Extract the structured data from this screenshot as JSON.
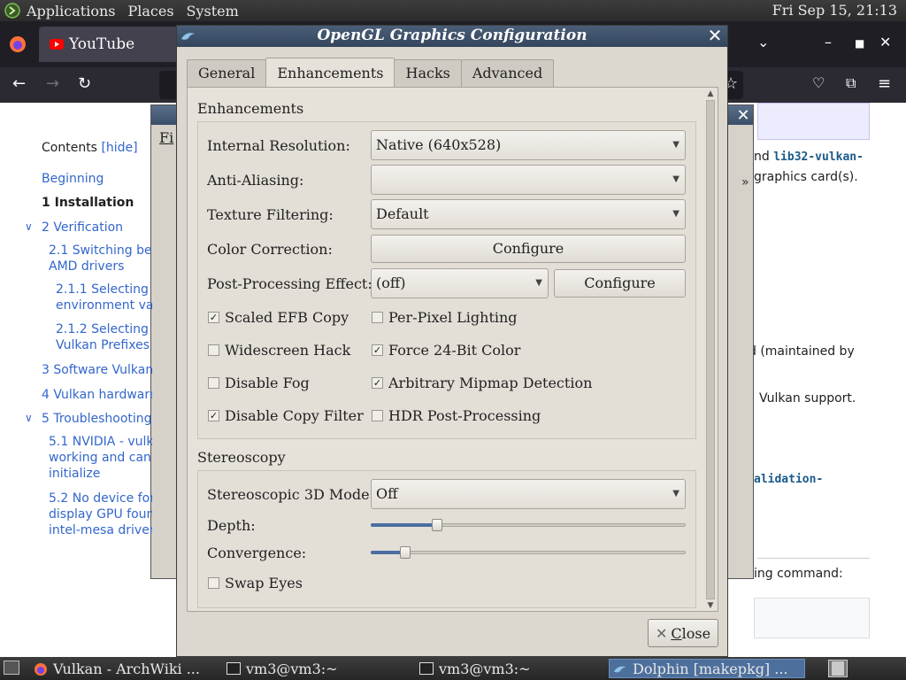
{
  "top_panel": {
    "menus": [
      "Applications",
      "Places",
      "System"
    ],
    "clock": "Fri Sep 15, 21:13"
  },
  "firefox": {
    "tab_title": "YouTube"
  },
  "wiki": {
    "toc_title": "Contents",
    "toc_hide": "[hide]",
    "toc": [
      {
        "num": "",
        "text": "Beginning"
      },
      {
        "num": "1",
        "text": "Installation"
      },
      {
        "num": "2",
        "text": "Verification"
      },
      {
        "num": "2.1",
        "text": "Switching betw"
      },
      {
        "num": "",
        "text": "AMD drivers"
      },
      {
        "num": "2.1.1",
        "text": "Selecting v"
      },
      {
        "num": "",
        "text": "environment varia"
      },
      {
        "num": "2.1.2",
        "text": "Selecting v"
      },
      {
        "num": "",
        "text": "Vulkan Prefixes"
      },
      {
        "num": "3",
        "text": "Software Vulkan:"
      },
      {
        "num": "4",
        "text": "Vulkan hardware"
      },
      {
        "num": "5",
        "text": "Troubleshooting"
      },
      {
        "num": "5.1",
        "text": "NVIDIA - vulka"
      },
      {
        "num": "",
        "text": "working and can n"
      },
      {
        "num": "",
        "text": "initialize"
      },
      {
        "num": "5.2",
        "text": "No device for t"
      },
      {
        "num": "",
        "text": "display GPU found"
      },
      {
        "num": "",
        "text": "intel-mesa drivers"
      }
    ],
    "right_texts": {
      "line1_prefix": "nd",
      "line1_code": "lib32-vulkan-",
      "line2": "graphics card(s).",
      "line3": "d (maintained by",
      "line4": "Vulkan support.",
      "line5_code": "alidation-",
      "line6": "ing command:"
    }
  },
  "dolphin_bg": {
    "menu_fragment": "Fi",
    "arrow": "»"
  },
  "dialog": {
    "title": "OpenGL Graphics Configuration",
    "tabs": [
      "General",
      "Enhancements",
      "Hacks",
      "Advanced"
    ],
    "active_tab": "Enhancements",
    "enhancements": {
      "group_title": "Enhancements",
      "internal_resolution_label": "Internal Resolution:",
      "internal_resolution_value": "Native (640x528)",
      "anti_aliasing_label": "Anti-Aliasing:",
      "anti_aliasing_value": "",
      "texture_filtering_label": "Texture Filtering:",
      "texture_filtering_value": "Default",
      "color_correction_label": "Color Correction:",
      "color_correction_button": "Configure",
      "post_processing_label": "Post-Processing Effect:",
      "post_processing_value": "(off)",
      "post_processing_button": "Configure",
      "checkboxes": [
        {
          "label": "Scaled EFB Copy",
          "checked": true
        },
        {
          "label": "Per-Pixel Lighting",
          "checked": false
        },
        {
          "label": "Widescreen Hack",
          "checked": false
        },
        {
          "label": "Force 24-Bit Color",
          "checked": true
        },
        {
          "label": "Disable Fog",
          "checked": false
        },
        {
          "label": "Arbitrary Mipmap Detection",
          "checked": true
        },
        {
          "label": "Disable Copy Filter",
          "checked": true
        },
        {
          "label": "HDR Post-Processing",
          "checked": false
        }
      ]
    },
    "stereoscopy": {
      "group_title": "Stereoscopy",
      "mode_label": "Stereoscopic 3D Mode:",
      "mode_value": "Off",
      "depth_label": "Depth:",
      "depth_value": 0.21,
      "convergence_label": "Convergence:",
      "convergence_value": 0.11,
      "swap_eyes_label": "Swap Eyes",
      "swap_eyes_checked": false
    },
    "close_button": "Close",
    "close_button_mnemonic": "C",
    "close_button_rest": "lose"
  },
  "taskbar": {
    "tasks": [
      {
        "label": "Vulkan - ArchWiki ...",
        "active": false
      },
      {
        "label": "vm3@vm3:~",
        "active": false
      },
      {
        "label": "vm3@vm3:~",
        "active": false
      },
      {
        "label": "Dolphin [makepkg] ...",
        "active": true
      }
    ]
  },
  "colors": {
    "titlebar": "#3b4f68",
    "dialog_bg": "#dcd8d0",
    "slider_fill": "#4a6ea0",
    "active_task": "#4d6f9c"
  }
}
